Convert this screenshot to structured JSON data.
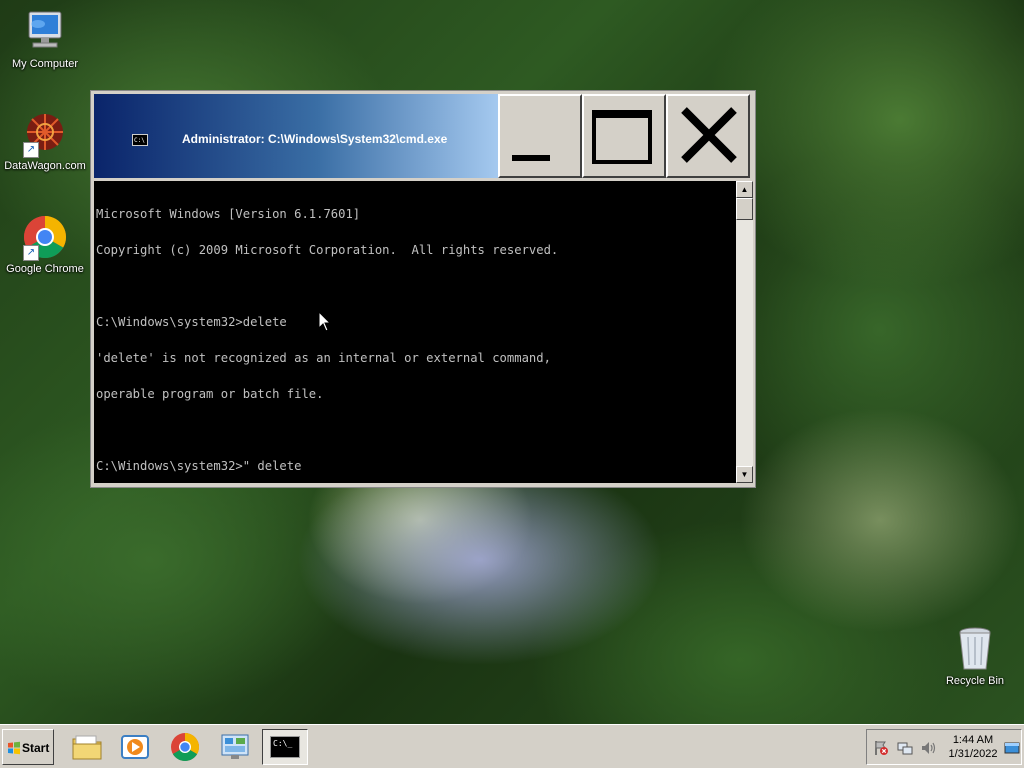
{
  "desktop": {
    "icons": [
      {
        "label": "My Computer"
      },
      {
        "label": "DataWagon.com"
      },
      {
        "label": "Google Chrome"
      },
      {
        "label": "Recycle Bin"
      }
    ]
  },
  "cmd_window": {
    "title": "Administrator: C:\\Windows\\System32\\cmd.exe",
    "icon_text": "C:\\",
    "console_lines": [
      "Microsoft Windows [Version 6.1.7601]",
      "Copyright (c) 2009 Microsoft Corporation.  All rights reserved.",
      "",
      "C:\\Windows\\system32>delete",
      "'delete' is not recognized as an internal or external command,",
      "operable program or batch file.",
      "",
      "C:\\Windows\\system32>\" delete"
    ]
  },
  "taskbar": {
    "start_label": "Start",
    "cmd_icon_text": "C:\\_",
    "clock_time": "1:44 AM",
    "clock_date": "1/31/2022"
  },
  "icons": {
    "start": "windows-flag-icon",
    "explorer": "folder-icon",
    "media": "media-player-icon",
    "chrome": "chrome-icon",
    "control": "control-panel-icon",
    "cmd": "command-prompt-icon"
  },
  "colors": {
    "console_bg": "#000000",
    "console_text": "#c0c0c0",
    "title_gradient_start": "#0a246a",
    "title_gradient_end": "#a6caf0"
  }
}
